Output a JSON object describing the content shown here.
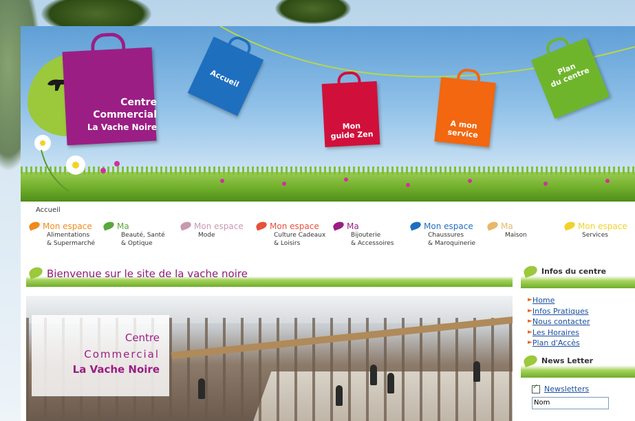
{
  "header": {
    "logo": {
      "line1": "Centre",
      "line2": "Commercial",
      "line3": "La Vache Noire"
    },
    "bags": [
      {
        "label": "Accueil",
        "color": "#1f6fbf"
      },
      {
        "label_line1": "Mon",
        "label_line2": "guide Zen",
        "color": "#d0103a"
      },
      {
        "label_line1": "A mon",
        "label_line2": "service",
        "color": "#f2670f"
      },
      {
        "label_line1": "Plan",
        "label_line2": "du centre",
        "color": "#6fb52c"
      }
    ]
  },
  "breadcrumb": "Accueil",
  "nav": [
    {
      "prefix": "Mon espace",
      "line1": "Alimentations",
      "line2": "& Supermarché",
      "color": "#f08a1a"
    },
    {
      "prefix": "Ma",
      "line1": "Beauté, Santé",
      "line2": "& Optique",
      "color": "#5aa83a"
    },
    {
      "prefix": "Mon espace",
      "line1": "Mode",
      "line2": "",
      "color": "#c89ab0"
    },
    {
      "prefix": "Mon espace",
      "line1": "Culture Cadeaux",
      "line2": "& Loisirs",
      "color": "#e8503a"
    },
    {
      "prefix": "Ma",
      "line1": "Bijouterie",
      "line2": "& Accessoires",
      "color": "#9b1e84"
    },
    {
      "prefix": "Mon espace",
      "line1": "Chaussures",
      "line2": "& Maroquinerie",
      "color": "#1f6fbf"
    },
    {
      "prefix": "Ma",
      "line1": "Maison",
      "line2": "",
      "color": "#e8b86a"
    },
    {
      "prefix": "Mon espace",
      "line1": "Services",
      "line2": "",
      "color": "#f2d22a"
    }
  ],
  "welcome": "Bienvenue sur le site de la vache noire",
  "photo_caption": {
    "line1": "Centre",
    "line2": "Commercial",
    "line3": "La Vache Noire"
  },
  "sidebar": {
    "infos_title": "Infos du centre",
    "links": [
      "Home",
      "Infos Pratiques",
      "Nous contacter",
      "Les Horaires",
      "Plan d'Accès"
    ],
    "news_title": "News Letter",
    "newsletter_label": "Newsletters",
    "name_value": "Nom"
  }
}
